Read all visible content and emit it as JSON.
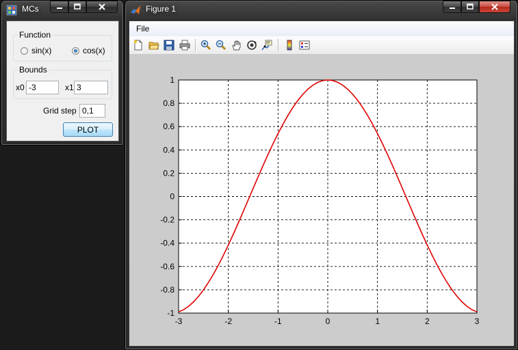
{
  "mcs_window": {
    "title": "MCs",
    "function_group": {
      "legend": "Function",
      "options": [
        {
          "label": "sin(x)",
          "selected": false
        },
        {
          "label": "cos(x)",
          "selected": true
        }
      ]
    },
    "bounds_group": {
      "legend": "Bounds",
      "x0_label": "x0",
      "x0_value": "-3",
      "x1_label": "x1",
      "x1_value": "3"
    },
    "grid_step_label": "Grid step",
    "grid_step_value": "0,1",
    "plot_button_label": "PLOT"
  },
  "figure_window": {
    "title": "Figure 1",
    "menu": [
      "File"
    ],
    "toolbar_icons": [
      "new-file-icon",
      "open-folder-icon",
      "save-icon",
      "print-icon",
      "zoom-in-icon",
      "zoom-out-icon",
      "pan-hand-icon",
      "rotate-3d-icon",
      "data-cursor-icon",
      "colorbar-icon",
      "legend-icon"
    ]
  },
  "colors": {
    "curve": "#e00000",
    "plot_bg": "#ffffff",
    "figure_bg": "#cccccc"
  },
  "chart_data": {
    "type": "line",
    "function": "cos(x)",
    "x_range": [
      -3,
      3
    ],
    "step": 0.1,
    "xlim": [
      -3,
      3
    ],
    "ylim": [
      -1,
      1
    ],
    "xticks": [
      "-3",
      "-2",
      "-1",
      "0",
      "1",
      "2",
      "3"
    ],
    "yticks": [
      "1",
      "0.8",
      "0.6",
      "0.4",
      "0.2",
      "0",
      "-0.2",
      "-0.4",
      "-0.6",
      "-0.8",
      "-1"
    ],
    "grid": true,
    "grid_style": "dashed",
    "series": [
      {
        "color": "#e00000"
      }
    ]
  }
}
